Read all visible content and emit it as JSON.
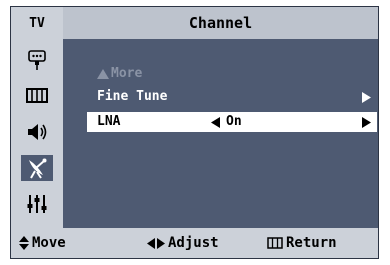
{
  "header": {
    "tv_label": "TV",
    "title": "Channel"
  },
  "sidebar": {
    "icons": [
      "input-icon",
      "picture-icon",
      "sound-icon",
      "channel-antenna-icon",
      "setup-icon"
    ],
    "active_index": 3
  },
  "menu": {
    "items": [
      {
        "label": "More",
        "state": "disabled"
      },
      {
        "label": "Fine Tune",
        "state": "normal"
      },
      {
        "label": "LNA",
        "value": "On",
        "state": "selected"
      }
    ]
  },
  "footer": {
    "move_label": "Move",
    "adjust_label": "Adjust",
    "return_label": "Return"
  },
  "colors": {
    "panel": "#4e5a72",
    "header": "#ccd1d9",
    "title_bar": "#bdc3cd",
    "highlight": "#ffffff",
    "disabled_text": "#8a93a5"
  }
}
